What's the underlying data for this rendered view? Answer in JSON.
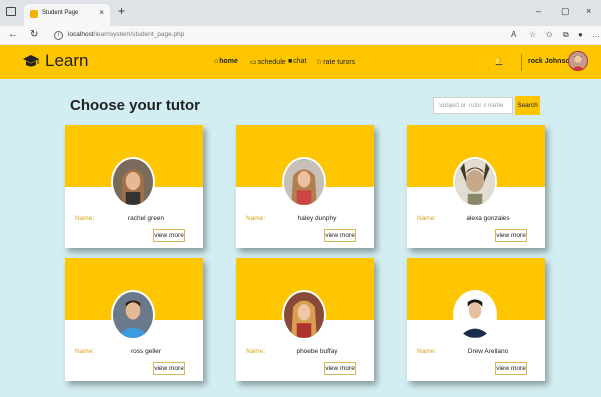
{
  "browser": {
    "tab_title": "Student Page",
    "tab_close": "×",
    "new_tab": "+",
    "url_host": "localhost",
    "url_path": "/learnsystem/student_page.php",
    "minimize": "–",
    "maximize": "▢",
    "close": "×"
  },
  "navbar": {
    "brand": "Learn",
    "items": [
      {
        "label": "home",
        "icon": "home-icon",
        "active": true
      },
      {
        "label": "schedule",
        "icon": "calendar-icon",
        "active": false
      },
      {
        "label": "chat",
        "icon": "chat-icon",
        "active": false
      },
      {
        "label": "rate turors",
        "icon": "star-icon",
        "active": false
      }
    ],
    "user_name": "rock Johnson"
  },
  "main": {
    "title": "Choose your tutor",
    "search_placeholder": "Subject or Tutor`s name",
    "search_button": "Search"
  },
  "tutors": [
    {
      "label": "Name:",
      "name": "rachel green",
      "button": "view more"
    },
    {
      "label": "Name:",
      "name": "haley dunphy",
      "button": "view more"
    },
    {
      "label": "Name:",
      "name": "alexa gonzales",
      "button": "view more"
    },
    {
      "label": "Name:",
      "name": "ross geller",
      "button": "view more"
    },
    {
      "label": "Name:",
      "name": "phoebe buffay",
      "button": "view more"
    },
    {
      "label": "Name:",
      "name": "Drew Arellano",
      "button": "view more"
    }
  ],
  "colors": {
    "accent": "#fdc600",
    "background": "#d3eef2",
    "label": "#d4a21c"
  }
}
